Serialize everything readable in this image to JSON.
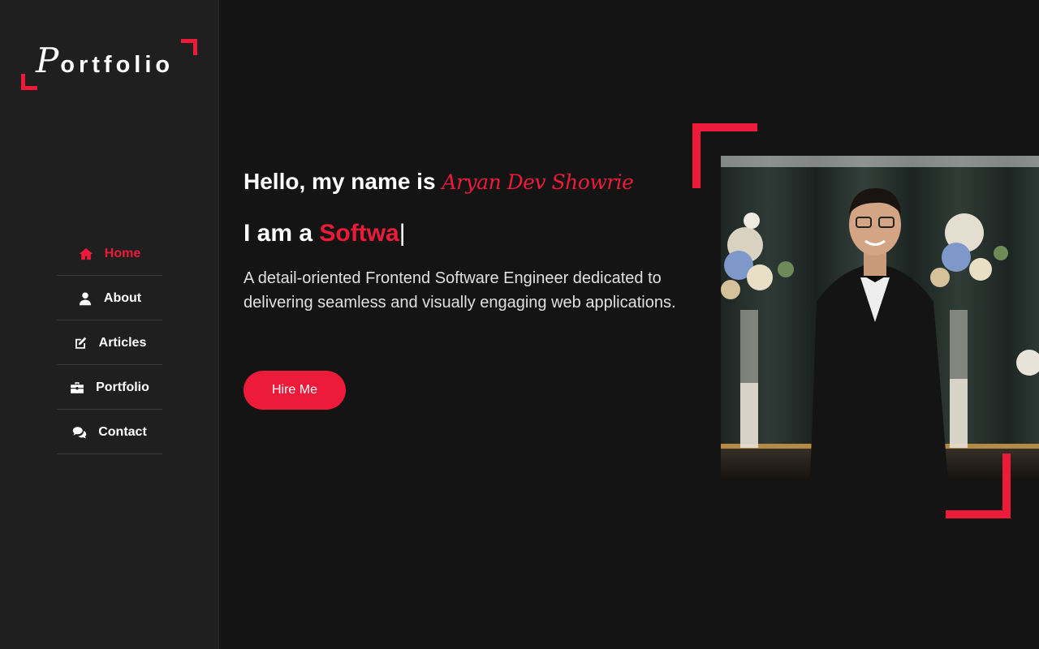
{
  "logo": {
    "initial": "P",
    "rest": "ortfolio"
  },
  "nav": {
    "items": [
      {
        "label": "Home",
        "icon": "home-icon",
        "active": true
      },
      {
        "label": "About",
        "icon": "user-icon",
        "active": false
      },
      {
        "label": "Articles",
        "icon": "edit-icon",
        "active": false
      },
      {
        "label": "Portfolio",
        "icon": "briefcase-icon",
        "active": false
      },
      {
        "label": "Contact",
        "icon": "chat-icon",
        "active": false
      }
    ]
  },
  "hero": {
    "greeting_prefix": "Hello, my name is",
    "name": "Aryan Dev Showrie",
    "role_prefix": "I am a",
    "role_typed": "Softwa",
    "cursor": "|",
    "description": "A detail-oriented Frontend Software Engineer dedicated to delivering seamless and visually engaging web applications.",
    "hire_label": "Hire Me"
  },
  "colors": {
    "accent": "#ed1b39",
    "background": "#141414",
    "sidebar": "#1f1f1f"
  }
}
